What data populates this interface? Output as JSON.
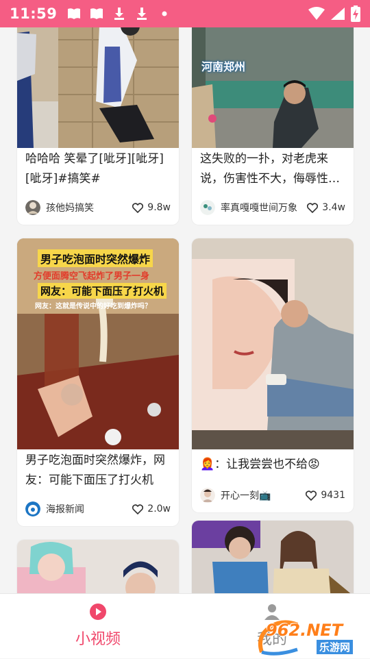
{
  "status_bar": {
    "time": "11:59",
    "background": "#f55d84",
    "left_icons": [
      "notification-book-icon",
      "notification-book-icon",
      "download-icon",
      "download-icon",
      "dot-icon"
    ],
    "right_icons": [
      "wifi-icon",
      "signal-icon",
      "battery-charging-icon"
    ]
  },
  "feed": {
    "cards": [
      {
        "caption": "哈哈哈 笑晕了[呲牙][呲牙][呲牙]#搞笑#",
        "author": "孩他妈搞笑",
        "likes": "9.8w"
      },
      {
        "caption": "这失败的一扑，对老虎来说，伤害性不大，侮辱性极强",
        "author": "率真嘎嘎世间万象",
        "likes": "3.4w",
        "overlay": "河南郑州"
      },
      {
        "caption": "男子吃泡面时突然爆炸，网友：可能下面压了打火机",
        "author": "海报新闻",
        "likes": "2.0w",
        "overlay_lines": [
          "男子吃泡面时突然爆炸",
          "方便面腾空飞起炸了男子一身",
          "网友：可能下面压了打火机",
          "网友：这就是传说中的好吃到爆炸吗？"
        ]
      },
      {
        "caption": "👩‍🦰：让我尝尝也不给😡",
        "author": "开心一刻📺",
        "likes": "9431"
      },
      {
        "caption": "",
        "author": "",
        "likes": ""
      },
      {
        "caption": "",
        "author": "",
        "likes": ""
      }
    ]
  },
  "bottom_nav": {
    "tabs": [
      {
        "label": "小视频",
        "active": true,
        "color": "#f0476b"
      },
      {
        "label": "我的",
        "active": false,
        "color": "#8a8a8a"
      }
    ]
  },
  "watermark": {
    "brand": "962.NET",
    "sub": "乐游网"
  },
  "colors": {
    "accent": "#f0476b",
    "text": "#222222"
  }
}
